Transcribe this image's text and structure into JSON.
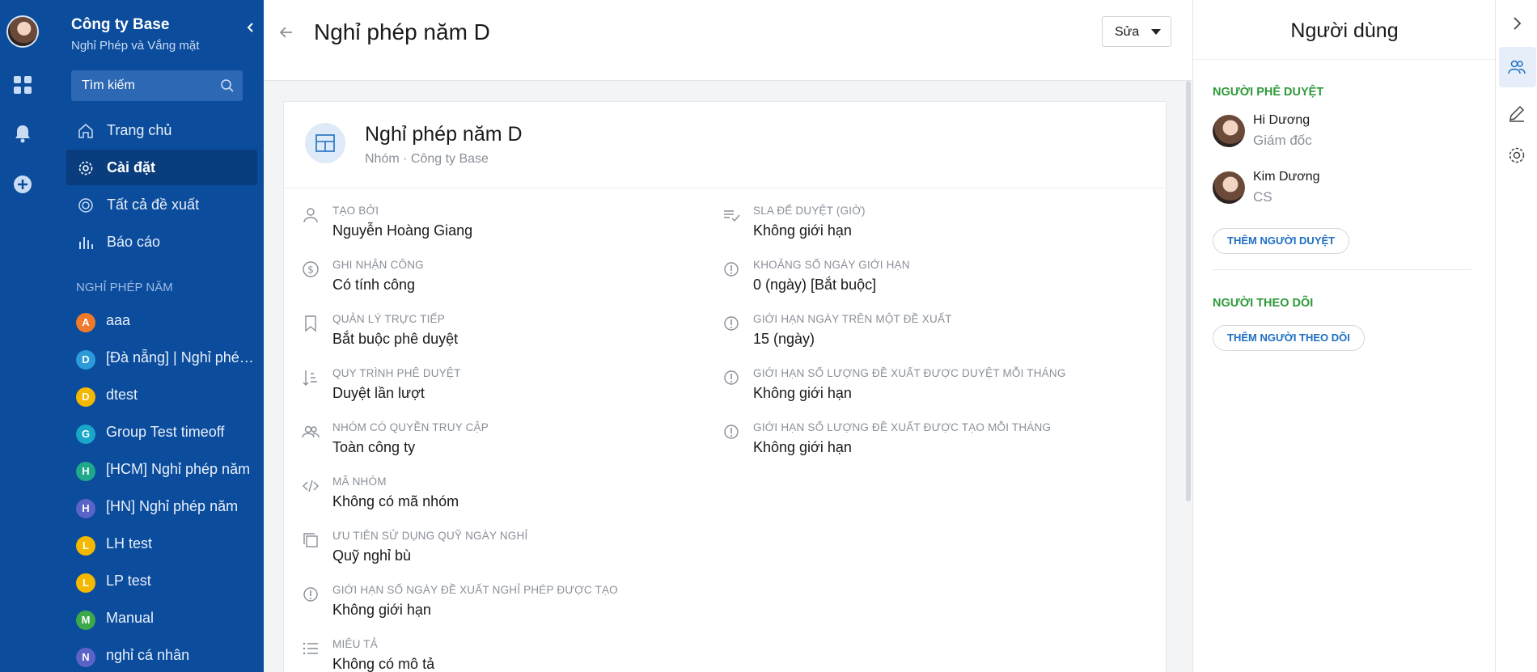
{
  "sidebar": {
    "company": "Công ty Base",
    "subtitle": "Nghỉ Phép và Vắng mặt",
    "search_placeholder": "Tìm kiếm",
    "nav": [
      {
        "label": "Trang chủ",
        "icon": "home-icon"
      },
      {
        "label": "Cài đặt",
        "icon": "gear-icon",
        "active": true
      },
      {
        "label": "Tất cả đề xuất",
        "icon": "target-icon"
      },
      {
        "label": "Báo cáo",
        "icon": "bar-chart-icon"
      }
    ],
    "section_title": "NGHỈ PHÉP NĂM",
    "groups": [
      {
        "letter": "A",
        "label": "aaa",
        "color": "#f07a2b"
      },
      {
        "letter": "D",
        "label": "[Đà nẵng] | Nghỉ phép năm",
        "color": "#2d9bd8"
      },
      {
        "letter": "D",
        "label": "dtest",
        "color": "#f5b800"
      },
      {
        "letter": "G",
        "label": "Group Test timeoff",
        "color": "#1aa6c9"
      },
      {
        "letter": "H",
        "label": "[HCM] Nghỉ phép năm",
        "color": "#1fa88a"
      },
      {
        "letter": "H",
        "label": "[HN] Nghỉ phép năm",
        "color": "#5a63c8"
      },
      {
        "letter": "L",
        "label": "LH test",
        "color": "#f5b800"
      },
      {
        "letter": "L",
        "label": "LP test",
        "color": "#f5b800"
      },
      {
        "letter": "M",
        "label": "Manual",
        "color": "#3ba84a"
      },
      {
        "letter": "N",
        "label": "nghỉ cá nhân",
        "color": "#5a63c8"
      }
    ]
  },
  "header": {
    "title": "Nghỉ phép năm D",
    "edit_label": "Sửa"
  },
  "card": {
    "title": "Nghỉ phép năm D",
    "subtitle": "Nhóm · Công ty Base"
  },
  "fields_left": [
    {
      "label": "TẠO BỞI",
      "value": "Nguyễn Hoàng Giang",
      "icon": "user-icon"
    },
    {
      "label": "GHI NHẬN CÔNG",
      "value": "Có tính công",
      "icon": "dollar-icon"
    },
    {
      "label": "QUẢN LÝ TRỰC TIẾP",
      "value": "Bắt buộc phê duyệt",
      "icon": "bookmark-icon"
    },
    {
      "label": "QUY TRÌNH PHÊ DUYỆT",
      "value": "Duyệt lần lượt",
      "icon": "sort-icon"
    },
    {
      "label": "NHÓM CÓ QUYỀN TRUY CẬP",
      "value": "Toàn công ty",
      "icon": "users-icon"
    },
    {
      "label": "MÃ NHÓM",
      "value": "Không có mã nhóm",
      "icon": "code-icon"
    },
    {
      "label": "ƯU TIÊN SỬ DỤNG QUỸ NGÀY NGHỈ",
      "value": "Quỹ nghỉ bù",
      "icon": "copy-icon"
    },
    {
      "label": "GIỚI HẠN SỐ NGÀY ĐỀ XUẤT NGHỈ PHÉP ĐƯỢC TẠO",
      "value": "Không giới hạn",
      "icon": "info-icon"
    },
    {
      "label": "MIÊU TẢ",
      "value": "Không có mô tả",
      "icon": "list-icon"
    }
  ],
  "fields_right": [
    {
      "label": "SLA ĐỂ DUYỆT (GIỜ)",
      "value": "Không giới hạn",
      "icon": "checklist-icon"
    },
    {
      "label": "KHOẢNG SỐ NGÀY GIỚI HẠN",
      "value": "0 (ngày) [Bắt buộc]",
      "icon": "info-icon"
    },
    {
      "label": "GIỚI HẠN NGÀY TRÊN MỘT ĐỀ XUẤT",
      "value": "15 (ngày)",
      "icon": "info-icon"
    },
    {
      "label": "GIỚI HẠN SỐ LƯỢNG ĐỀ XUẤT ĐƯỢC DUYỆT MỖI THÁNG",
      "value": "Không giới hạn",
      "icon": "info-icon"
    },
    {
      "label": "GIỚI HẠN SỐ LƯỢNG ĐỀ XUẤT ĐƯỢC TẠO MỖI THÁNG",
      "value": "Không giới hạn",
      "icon": "info-icon"
    }
  ],
  "right_panel": {
    "title": "Người dùng",
    "approvers_title": "NGƯỜI PHÊ DUYỆT",
    "approvers": [
      {
        "name": "Hi Dương",
        "role": "Giám đốc"
      },
      {
        "name": "Kim Dương",
        "role": "CS"
      }
    ],
    "add_approver": "THÊM NGƯỜI DUYỆT",
    "followers_title": "NGƯỜI THEO DÕI",
    "add_follower": "THÊM NGƯỜI THEO DÕI"
  },
  "colors": {
    "sidebar_bg": "#0b4c9c",
    "accent_green": "#2e9a3a",
    "link_blue": "#1f6fc2"
  }
}
